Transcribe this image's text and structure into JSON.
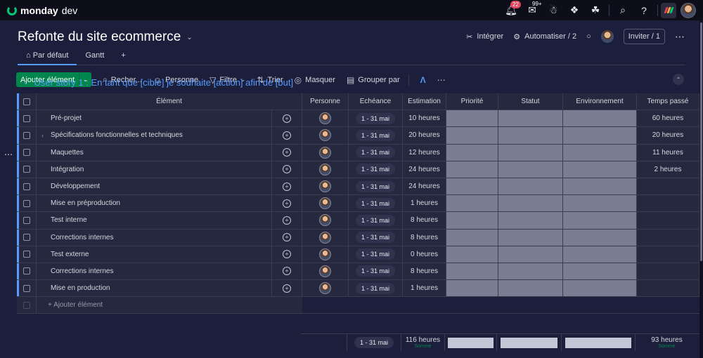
{
  "app": {
    "logo_bold": "monday",
    "logo_light": "dev"
  },
  "topbar": {
    "notifications_count": "22",
    "inbox_count": "99+",
    "icons": [
      "bell-icon",
      "inbox-icon",
      "invite-members-icon",
      "apps-icon",
      "integrations-icon",
      "search-icon",
      "help-icon"
    ]
  },
  "board": {
    "title": "Refonte du site ecommerce",
    "actions": {
      "integrate": "Intégrer",
      "automate": "Automatiser / 2",
      "invite": "Inviter / 1"
    },
    "tabs": [
      {
        "label": "Par défaut"
      },
      {
        "label": "Gantt"
      },
      {
        "label": "+"
      }
    ]
  },
  "toolbar": {
    "add_item": "Ajouter élément",
    "search": "Recher...",
    "person": "Personne",
    "filter": "Filtre",
    "sort": "Trier",
    "hide": "Masquer",
    "group_by": "Grouper par"
  },
  "group": {
    "title": "User story 1 : En tant que [cible] je souhaite [action] afin de [but]",
    "columns": {
      "element": "Élément",
      "person": "Personne",
      "due": "Echéance",
      "estimate": "Estimation",
      "priority": "Priorité",
      "status": "Statut",
      "environment": "Environnement",
      "time_spent": "Temps passé"
    },
    "rows": [
      {
        "name": "Pré-projet",
        "due": "1 - 31 mai",
        "estimate": "10 heures",
        "time_spent": "60 heures"
      },
      {
        "name": "Spécifications fonctionnelles et techniques",
        "due": "1 - 31 mai",
        "estimate": "20 heures",
        "time_spent": "20 heures"
      },
      {
        "name": "Maquettes",
        "due": "1 - 31 mai",
        "estimate": "12 heures",
        "time_spent": "11 heures"
      },
      {
        "name": "Intégration",
        "due": "1 - 31 mai",
        "estimate": "24 heures",
        "time_spent": "2 heures"
      },
      {
        "name": "Développement",
        "due": "1 - 31 mai",
        "estimate": "24 heures",
        "time_spent": ""
      },
      {
        "name": "Mise en préproduction",
        "due": "1 - 31 mai",
        "estimate": "1 heures",
        "time_spent": ""
      },
      {
        "name": "Test interne",
        "due": "1 - 31 mai",
        "estimate": "8 heures",
        "time_spent": ""
      },
      {
        "name": "Corrections internes",
        "due": "1 - 31 mai",
        "estimate": "8 heures",
        "time_spent": ""
      },
      {
        "name": "Test externe",
        "due": "1 - 31 mai",
        "estimate": "0 heures",
        "time_spent": ""
      },
      {
        "name": "Corrections internes",
        "due": "1 - 31 mai",
        "estimate": "8 heures",
        "time_spent": ""
      },
      {
        "name": "Mise en production",
        "due": "1 - 31 mai",
        "estimate": "1 heures",
        "time_spent": ""
      }
    ],
    "add_item": "+ Ajouter élément",
    "summary": {
      "due": "1 - 31 mai",
      "estimate": "116 heures",
      "estimate_label": "Somme",
      "time_spent": "93 heures",
      "time_spent_label": "Somme"
    }
  },
  "colors": {
    "accent": "#579bfc",
    "primary_button": "#00854d",
    "empty_cell": "#797e93"
  }
}
